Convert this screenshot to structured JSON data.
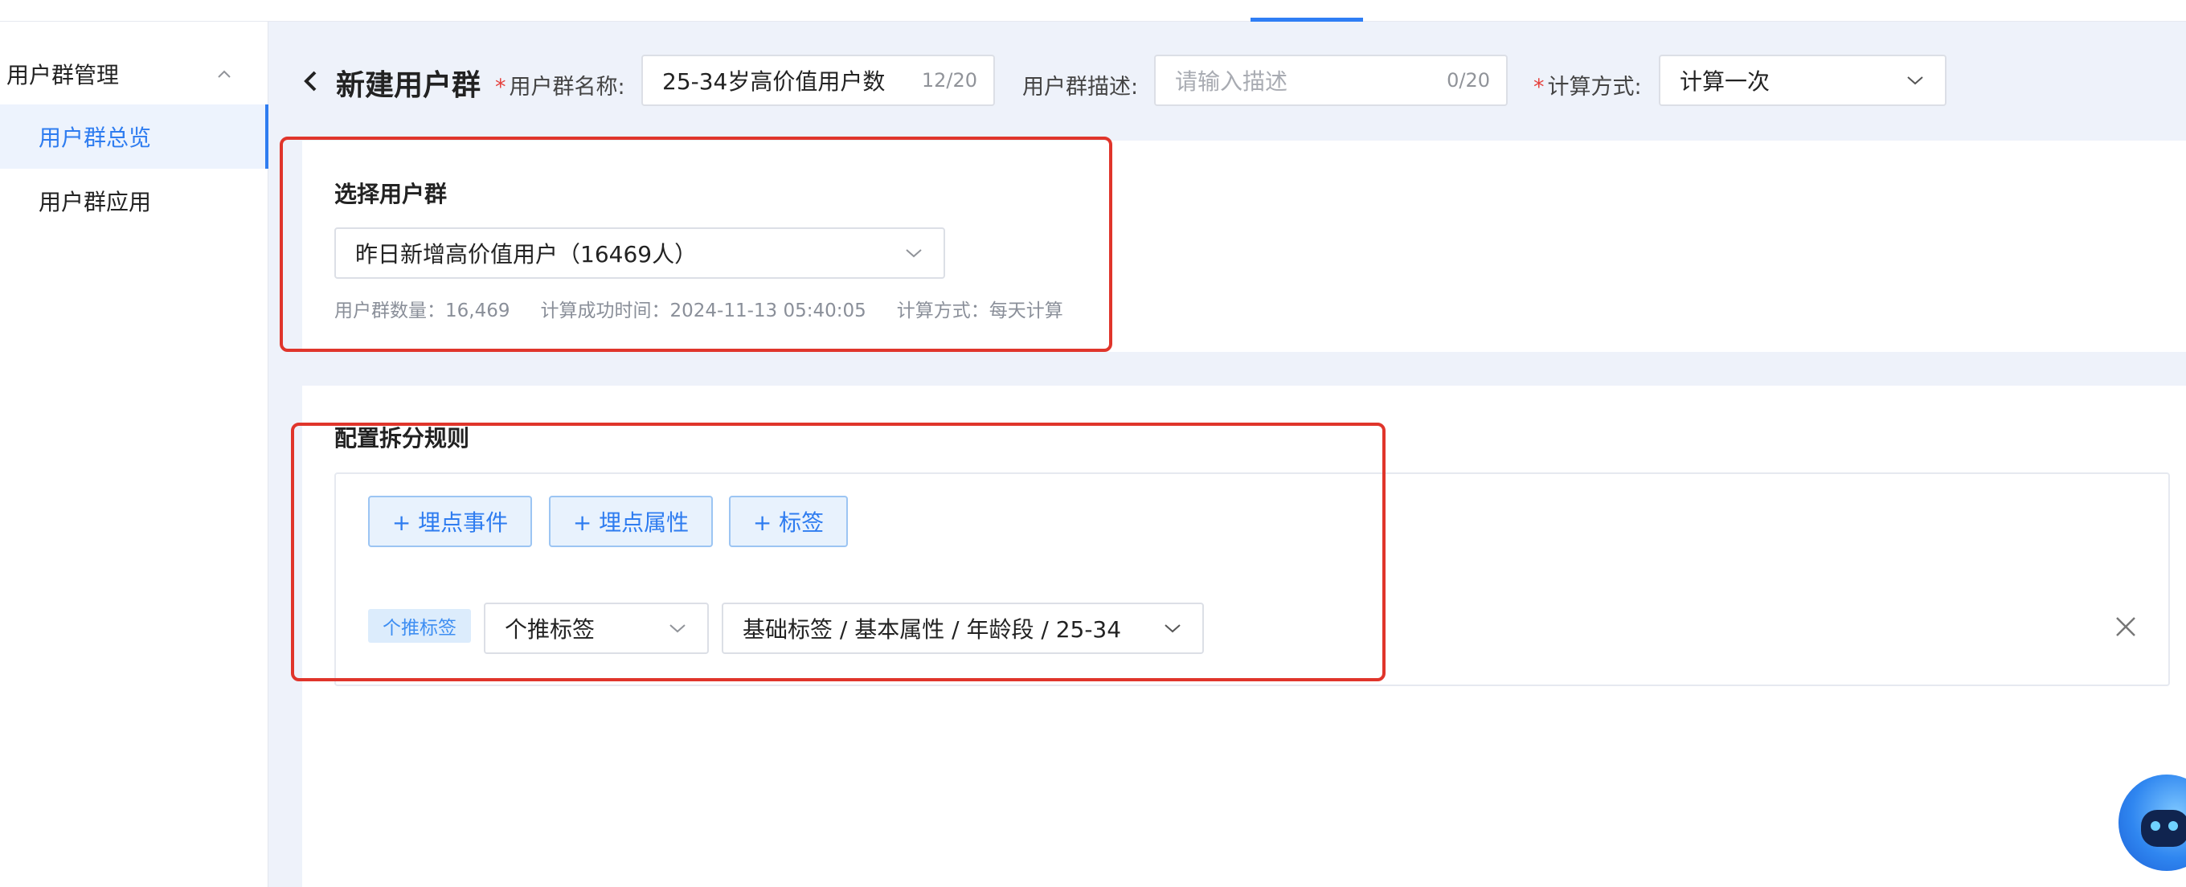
{
  "sidebar": {
    "group_label": "用户群管理",
    "items": [
      {
        "label": "用户群总览",
        "active": true
      },
      {
        "label": "用户群应用",
        "active": false
      }
    ]
  },
  "header": {
    "title": "新建用户群",
    "name_label": "用户群名称:",
    "name_value": "25-34岁高价值用户数",
    "name_count": "12/20",
    "desc_label": "用户群描述:",
    "desc_placeholder": "请输入描述",
    "desc_count": "0/20",
    "calc_label": "计算方式:",
    "calc_value": "计算一次",
    "required_mark": "*"
  },
  "select_group": {
    "title": "选择用户群",
    "selected": "昨日新增高价值用户（16469人）",
    "count_text": "用户群数量：16,469",
    "success_time_text": "计算成功时间：2024-11-13 05:40:05",
    "calc_method_text": "计算方式：每天计算"
  },
  "split_rules": {
    "title": "配置拆分规则",
    "buttons": [
      "+ 埋点事件",
      "+ 埋点属性",
      "+ 标签"
    ],
    "rule": {
      "tag": "个推标签",
      "type_value": "个推标签",
      "path_value": "基础标签 / 基本属性 / 年龄段 / 25-34"
    }
  },
  "colors": {
    "accent": "#2e7cf0",
    "highlight": "#e0352b",
    "required": "#e5413d",
    "background": "#eef2fa"
  },
  "icons": [
    "back-icon",
    "chevron-up-icon",
    "chevron-down-icon",
    "close-icon",
    "assistant-icon"
  ]
}
